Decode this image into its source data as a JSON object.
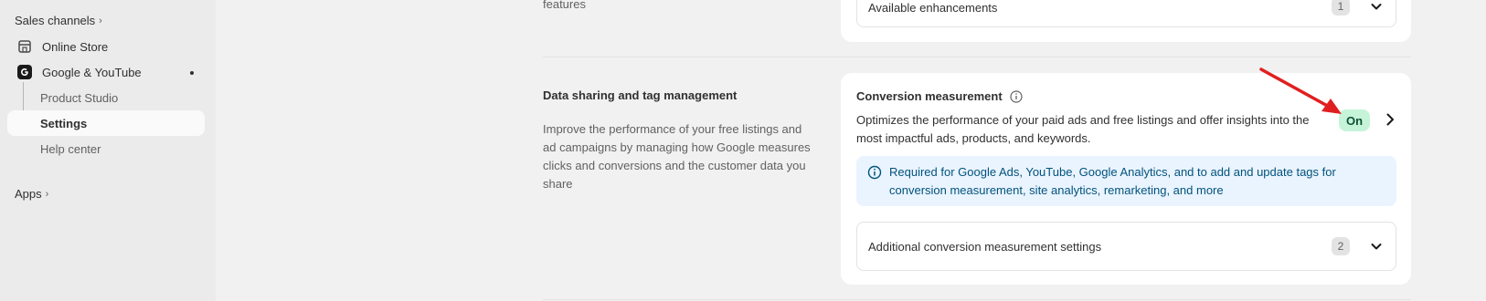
{
  "sidebar": {
    "sales_channels": "Sales channels",
    "online_store": "Online Store",
    "google_youtube": "Google & YouTube",
    "product_studio": "Product Studio",
    "settings": "Settings",
    "help_center": "Help center",
    "apps": "Apps"
  },
  "top": {
    "partial_text": "features",
    "enhancements_label": "Available enhancements",
    "enhancements_count": "1"
  },
  "section": {
    "title": "Data sharing and tag management",
    "description": "Improve the performance of your free listings and ad campaigns by managing how Google measures clicks and conversions and the customer data you share"
  },
  "conversion": {
    "title": "Conversion measurement",
    "description": "Optimizes the performance of your paid ads and free listings and offer insights into the most impactful ads, products, and keywords.",
    "status": "On",
    "banner": "Required for Google Ads, YouTube, Google Analytics, and to add and update tags for conversion measurement, site analytics, remarketing, and more",
    "additional_label": "Additional conversion measurement settings",
    "additional_count": "2"
  },
  "colors": {
    "sidebar_bg": "#ebebeb",
    "page_bg": "#f1f1f1",
    "badge_bg": "#c5f4d9",
    "banner_bg": "#eaf4ff",
    "annotation_arrow": "#e02020"
  }
}
